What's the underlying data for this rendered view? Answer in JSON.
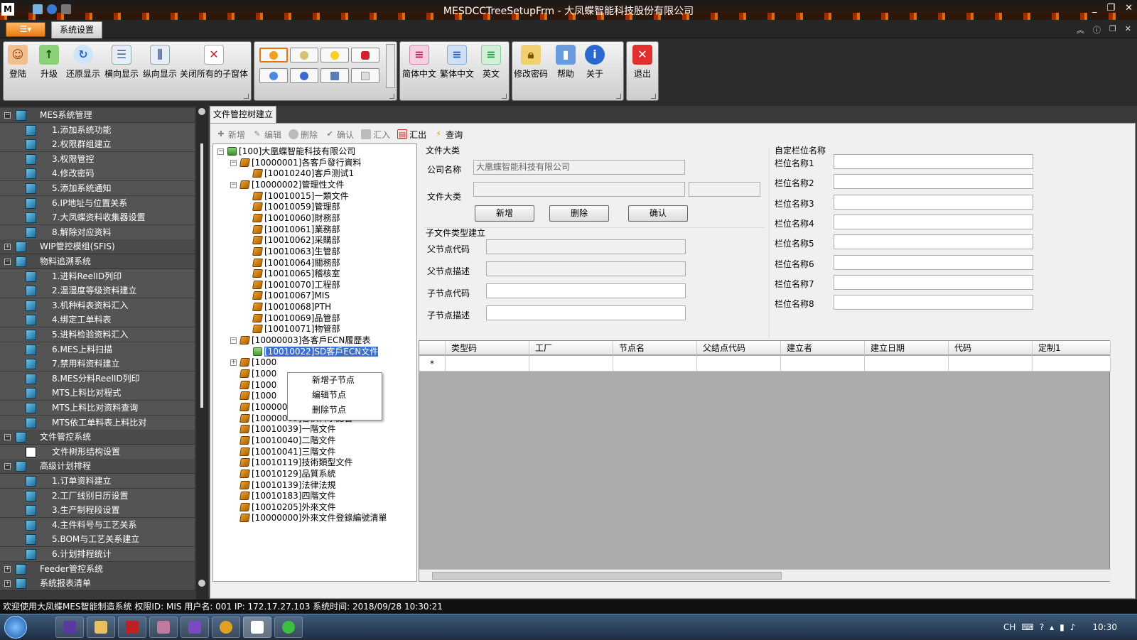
{
  "window": {
    "title": "MESDCCTreeSetupFrm - 大凤蝶智能科技股份有限公司"
  },
  "ribbon_tab": "系统设置",
  "ribbon": {
    "group1": [
      "登陆",
      "升级",
      "还原显示",
      "横向显示",
      "纵向显示",
      "关闭所有的子窗体"
    ],
    "group3": [
      "简体中文",
      "繁体中文",
      "英文"
    ],
    "group4": [
      "修改密码",
      "帮助",
      "关于"
    ],
    "group5": [
      "退出"
    ]
  },
  "nav": [
    {
      "label": "MES系统管理",
      "level": 0,
      "expanded": true
    },
    {
      "label": "1.添加系统功能",
      "level": 1
    },
    {
      "label": "2.权限群组建立",
      "level": 1
    },
    {
      "label": "3.权限管控",
      "level": 1
    },
    {
      "label": "4.修改密码",
      "level": 1
    },
    {
      "label": "5.添加系统通知",
      "level": 1
    },
    {
      "label": "6.IP地址与位置关系",
      "level": 1
    },
    {
      "label": "7.大凤蝶资料收集器设置",
      "level": 1
    },
    {
      "label": "8.解除对应资料",
      "level": 1
    },
    {
      "label": "WIP管控模组(SFIS)",
      "level": 0,
      "expanded": false
    },
    {
      "label": "物料追溯系统",
      "level": 0,
      "expanded": true
    },
    {
      "label": "1.进料ReelID列印",
      "level": 1
    },
    {
      "label": "2.温湿度等级资料建立",
      "level": 1
    },
    {
      "label": "3.机种料表资料汇入",
      "level": 1
    },
    {
      "label": "4.绑定工单料表",
      "level": 1
    },
    {
      "label": "5.进料检验资料汇入",
      "level": 1
    },
    {
      "label": "6.MES上料扫描",
      "level": 1
    },
    {
      "label": "7.禁用料资料建立",
      "level": 1
    },
    {
      "label": "8.MES分料ReelID列印",
      "level": 1
    },
    {
      "label": "MTS上料比对程式",
      "level": 1
    },
    {
      "label": "MTS上料比对资料查询",
      "level": 1
    },
    {
      "label": "MTS依工单料表上料比对",
      "level": 1
    },
    {
      "label": "文件管控系统",
      "level": 0,
      "expanded": true
    },
    {
      "label": "文件树形结构设置",
      "level": 1,
      "special": true
    },
    {
      "label": "高级计划排程",
      "level": 0,
      "expanded": true
    },
    {
      "label": "1.订单资料建立",
      "level": 1
    },
    {
      "label": "2.工厂线别日历设置",
      "level": 1
    },
    {
      "label": "3.生产制程段设置",
      "level": 1
    },
    {
      "label": "4.主件料号与工艺关系",
      "level": 1
    },
    {
      "label": "5.BOM与工艺关系建立",
      "level": 1
    },
    {
      "label": "6.计划排程统计",
      "level": 1
    },
    {
      "label": "Feeder管控系统",
      "level": 0,
      "expanded": false
    },
    {
      "label": "系统报表清单",
      "level": 0,
      "expanded": false
    }
  ],
  "doc_tab": "文件管控树建立",
  "toolbar": [
    "新增",
    "编辑",
    "删除",
    "确认",
    "汇入",
    "汇出",
    "查询"
  ],
  "tree": [
    {
      "label": "[100]大凰蝶智能科技有限公司",
      "level": 0,
      "type": "root",
      "pm": "-"
    },
    {
      "label": "[10000001]各客戶發行資料",
      "level": 1,
      "pm": "-"
    },
    {
      "label": "[10010240]客戶测试1",
      "level": 2
    },
    {
      "label": "[10000002]管理性文件",
      "level": 1,
      "pm": "-"
    },
    {
      "label": "[10010015]一類文件",
      "level": 2
    },
    {
      "label": "[10010059]管理部",
      "level": 2
    },
    {
      "label": "[10010060]財務部",
      "level": 2
    },
    {
      "label": "[10010061]業務部",
      "level": 2
    },
    {
      "label": "[10010062]采購部",
      "level": 2
    },
    {
      "label": "[10010063]生管部",
      "level": 2
    },
    {
      "label": "[10010064]關務部",
      "level": 2
    },
    {
      "label": "[10010065]稽核室",
      "level": 2
    },
    {
      "label": "[10010070]工程部",
      "level": 2
    },
    {
      "label": "[10010067]MIS",
      "level": 2
    },
    {
      "label": "[10010068]PTH",
      "level": 2
    },
    {
      "label": "[10010069]品管部",
      "level": 2
    },
    {
      "label": "[10010071]物管部",
      "level": 2
    },
    {
      "label": "[10000003]各客戶ECN履歷表",
      "level": 1,
      "pm": "-"
    },
    {
      "label": "[10010022]SD客戶ECN文件",
      "level": 2,
      "type": "leaf",
      "selected": true
    },
    {
      "label": "[1000",
      "level": 1,
      "pm": "+"
    },
    {
      "label": "[1000",
      "level": 1
    },
    {
      "label": "[1000",
      "level": 1
    },
    {
      "label": "[1000",
      "level": 1
    },
    {
      "label": "[10000008]品質系統文件",
      "level": 1
    },
    {
      "label": "[10000009]客供料承認書",
      "level": 1
    },
    {
      "label": "[10010039]一階文件",
      "level": 1
    },
    {
      "label": "[10010040]二階文件",
      "level": 1
    },
    {
      "label": "[10010041]三階文件",
      "level": 1
    },
    {
      "label": "[10010119]技術類型文件",
      "level": 1
    },
    {
      "label": "[10010129]品質系統",
      "level": 1
    },
    {
      "label": "[10010139]法律法規",
      "level": 1
    },
    {
      "label": "[10010183]四階文件",
      "level": 1
    },
    {
      "label": "[10010205]外來文件",
      "level": 1
    },
    {
      "label": "[10000000]外來文件登錄編號清單",
      "level": 1
    }
  ],
  "context_menu": [
    "新增子节点",
    "编辑节点",
    "删除节点"
  ],
  "form": {
    "section1": "文件大类",
    "company_label": "公司名称",
    "company_value": "大凰蝶智能科技有限公司",
    "category_label": "文件大类",
    "btn_add": "新增",
    "btn_delete": "删除",
    "btn_confirm": "确认",
    "section2": "子文件类型建立",
    "parent_code_label": "父节点代码",
    "parent_desc_label": "父节点描述",
    "child_code_label": "子节点代码",
    "child_desc_label": "子节点描述"
  },
  "custom": {
    "title": "自定栏位名称",
    "labels": [
      "栏位名称1",
      "栏位名称2",
      "栏位名称3",
      "栏位名称4",
      "栏位名称5",
      "栏位名称6",
      "栏位名称7",
      "栏位名称8"
    ]
  },
  "grid": {
    "columns": [
      "类型码",
      "工厂",
      "节点名",
      "父结点代码",
      "建立者",
      "建立日期",
      "代码",
      "定制1"
    ],
    "new_row_marker": "*"
  },
  "status": "欢迎使用大凤蝶MES智能制造系统  权限ID: MIS  用户名: 001  IP: 172.17.27.103  系统时间: 2018/09/28 10:30:21",
  "taskbar": {
    "lang": "CH",
    "time": "10:30"
  }
}
